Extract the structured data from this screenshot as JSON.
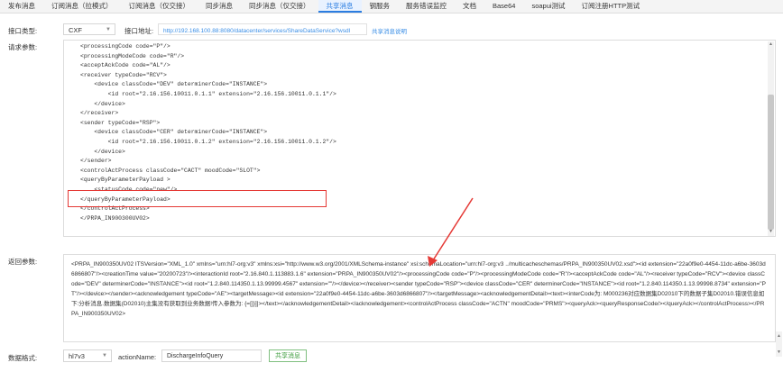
{
  "tabs": [
    "发布消息",
    "订阅消息（拉模式）",
    "订阅消息（仅交接）",
    "同步消息",
    "同步消息（仅交接）",
    "共享消息",
    "钢服务",
    "服务错误监控",
    "文档",
    "Base64",
    "soapui测试",
    "订阅注册HTTP测试"
  ],
  "active_tab_index": 5,
  "interface_type": {
    "label": "接口类型:",
    "value": "CXF"
  },
  "interface_addr": {
    "label": "接口地址:",
    "url": "http://192.168.100.88:8080/datacenter/services/ShareDataService?wsdl",
    "link": "共享消息说明"
  },
  "request": {
    "label": "请求参数:",
    "lines": [
      "<processingCode code=\"P\"/>",
      "<processingModeCode code=\"R\"/>",
      "<acceptAckCode code=\"AL\"/>",
      "<receiver typeCode=\"RCV\">",
      "    <device classCode=\"DEV\" determinerCode=\"INSTANCE\">",
      "        <id root=\"2.16.156.10011.0.1.1\" extension=\"2.16.156.10011.0.1.1\"/>",
      "    </device>",
      "</receiver>",
      "<sender typeCode=\"RSP\">",
      "    <device classCode=\"CER\" determinerCode=\"INSTANCE\">",
      "        <id root=\"2.16.156.10011.0.1.2\" extension=\"2.16.156.10011.0.1.2\"/>",
      "    </device>",
      "</sender>",
      "<controlActProcess classCode=\"CACT\" moodCode=\"SLOT\">",
      "<queryByParameterPayload >",
      "    <statusCode code=\"new\"/>",
      "",
      "</queryByParameterPayload>",
      "</controlActProcess>",
      "</PRPA_IN900300UV02>"
    ]
  },
  "response": {
    "label": "返回参数:",
    "text": "<PRPA_IN900350UV02 ITSVersion=\"XML_1.0\" xmlns=\"urn:hl7-org:v3\" xmlns:xsi=\"http://www.w3.org/2001/XMLSchema-instance\" xsi:schemaLocation=\"urn:hl7-org:v3 ../multicacheschemas/PRPA_IN900350UV02.xsd\"><id extension=\"22a0f9e0-4454-11dc-a6be-3603d6866807\"/><creationTime value=\"20200723\"/><interactionId root=\"2.16.840.1.113883.1.6\" extension=\"PRPA_IN900350UV02\"/><processingCode code=\"P\"/><processingModeCode code=\"R\"/><acceptAckCode code=\"AL\"/><receiver typeCode=\"RCV\"><device classCode=\"DEV\" determinerCode=\"INSTANCE\"><id root=\"1.2.840.114350.1.13.99999.4567\" extension=\"\"/></device></receiver><sender typeCode=\"RSP\"><device classCode=\"CER\" determinerCode=\"INSTANCE\"><id root=\"1.2.840.114350.1.13.99998.8734\" extension=\"PT\"/></device></sender><acknowledgement typeCode=\"AE\"><targetMessage><id extension=\"22a0f9e0-4454-11dc-a6be-3603d6866807\"/></targetMessage><acknowledgementDetail><text><interCode为: M000236对应数据集D02010下的数据子集D02010.错误信息如下:分析消息.数据集(D02010)主集没有获取到业务数据!传入参数为: {=[]}]]></text></acknowledgementDetail></acknowledgement><controlActProcess classCode=\"ACTN\" moodCode=\"PRMS\"><queryAck><queryResponseCode/></queryAck></controlActProcess></PRPA_IN900350UV02>"
  },
  "data_format": {
    "label": "数据格式:",
    "value": "hl7v3"
  },
  "action_name": {
    "label": "actionName:",
    "value": "DischargeInfoQuery"
  },
  "submit_label": "共享消息",
  "colors": {
    "accent": "#2b7de1",
    "annotation": "#e53935",
    "button": "#3c9c3c"
  }
}
